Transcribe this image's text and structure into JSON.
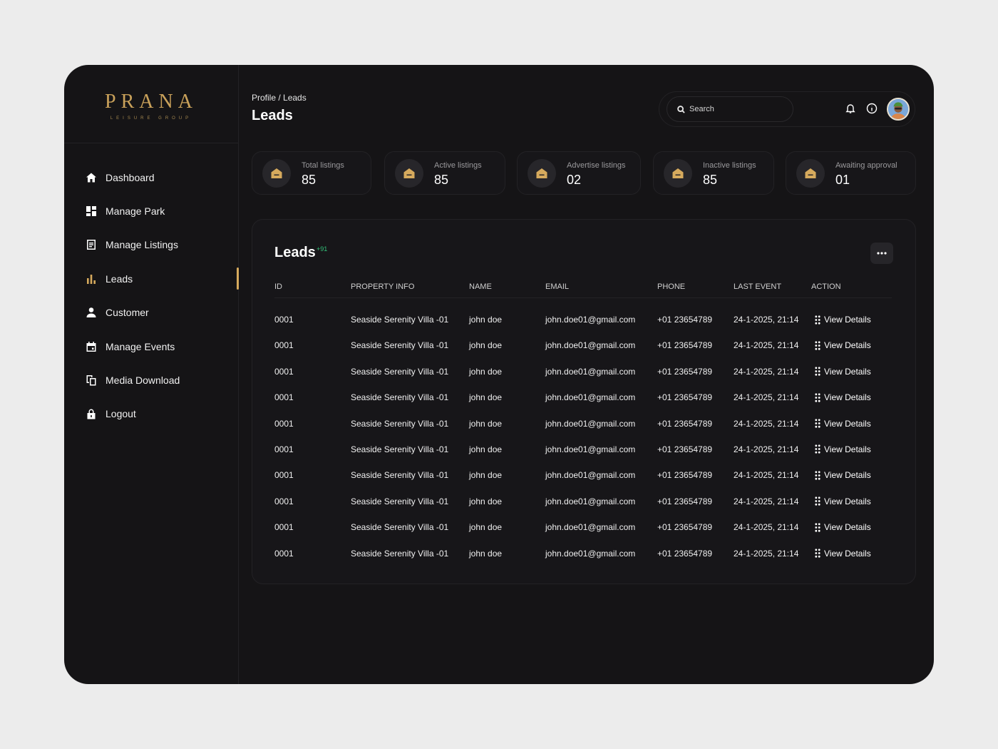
{
  "brand": {
    "name": "PRANA",
    "tagline": "LEISURE GROUP",
    "accent_color": "#d6aa5d"
  },
  "sidebar": {
    "items": [
      {
        "label": "Dashboard",
        "icon": "home-icon"
      },
      {
        "label": "Manage Park",
        "icon": "grid-icon"
      },
      {
        "label": "Manage Listings",
        "icon": "list-icon"
      },
      {
        "label": "Leads",
        "icon": "bar-chart-icon",
        "active": true
      },
      {
        "label": "Customer",
        "icon": "user-icon"
      },
      {
        "label": "Manage Events",
        "icon": "calendar-icon"
      },
      {
        "label": "Media Download",
        "icon": "copy-icon"
      },
      {
        "label": "Logout",
        "icon": "lock-icon"
      }
    ]
  },
  "header": {
    "breadcrumb": "Profile / Leads",
    "title": "Leads",
    "search_placeholder": "Search"
  },
  "stats": [
    {
      "label": "Total listings",
      "value": "85"
    },
    {
      "label": "Active listings",
      "value": "85"
    },
    {
      "label": "Advertise listings",
      "value": "02"
    },
    {
      "label": "Inactive listings",
      "value": "85"
    },
    {
      "label": "Awaiting approval",
      "value": "01"
    }
  ],
  "leads_table": {
    "title": "Leads",
    "badge": "+91",
    "badge_color": "#33c27a",
    "columns": [
      "ID",
      "PROPERTY INFO",
      "NAME",
      "EMAIL",
      "PHONE",
      "LAST EVENT",
      "ACTION"
    ],
    "rows": [
      {
        "id": "0001",
        "property": "Seaside Serenity Villa -01",
        "name": "john doe",
        "email": "john.doe01@gmail.com",
        "phone": "+01 23654789",
        "last_event": "24-1-2025, 21:14",
        "action": "View Details"
      },
      {
        "id": "0001",
        "property": "Seaside Serenity Villa -01",
        "name": "john doe",
        "email": "john.doe01@gmail.com",
        "phone": "+01 23654789",
        "last_event": "24-1-2025, 21:14",
        "action": "View Details"
      },
      {
        "id": "0001",
        "property": "Seaside Serenity Villa -01",
        "name": "john doe",
        "email": "john.doe01@gmail.com",
        "phone": "+01 23654789",
        "last_event": "24-1-2025, 21:14",
        "action": "View Details"
      },
      {
        "id": "0001",
        "property": "Seaside Serenity Villa -01",
        "name": "john doe",
        "email": "john.doe01@gmail.com",
        "phone": "+01 23654789",
        "last_event": "24-1-2025, 21:14",
        "action": "View Details"
      },
      {
        "id": "0001",
        "property": "Seaside Serenity Villa -01",
        "name": "john doe",
        "email": "john.doe01@gmail.com",
        "phone": "+01 23654789",
        "last_event": "24-1-2025, 21:14",
        "action": "View Details"
      },
      {
        "id": "0001",
        "property": "Seaside Serenity Villa -01",
        "name": "john doe",
        "email": "john.doe01@gmail.com",
        "phone": "+01 23654789",
        "last_event": "24-1-2025, 21:14",
        "action": "View Details"
      },
      {
        "id": "0001",
        "property": "Seaside Serenity Villa -01",
        "name": "john doe",
        "email": "john.doe01@gmail.com",
        "phone": "+01 23654789",
        "last_event": "24-1-2025, 21:14",
        "action": "View Details"
      },
      {
        "id": "0001",
        "property": "Seaside Serenity Villa -01",
        "name": "john doe",
        "email": "john.doe01@gmail.com",
        "phone": "+01 23654789",
        "last_event": "24-1-2025, 21:14",
        "action": "View Details"
      },
      {
        "id": "0001",
        "property": "Seaside Serenity Villa -01",
        "name": "john doe",
        "email": "john.doe01@gmail.com",
        "phone": "+01 23654789",
        "last_event": "24-1-2025, 21:14",
        "action": "View Details"
      },
      {
        "id": "0001",
        "property": "Seaside Serenity Villa -01",
        "name": "john doe",
        "email": "john.doe01@gmail.com",
        "phone": "+01 23654789",
        "last_event": "24-1-2025, 21:14",
        "action": "View Details"
      }
    ]
  }
}
